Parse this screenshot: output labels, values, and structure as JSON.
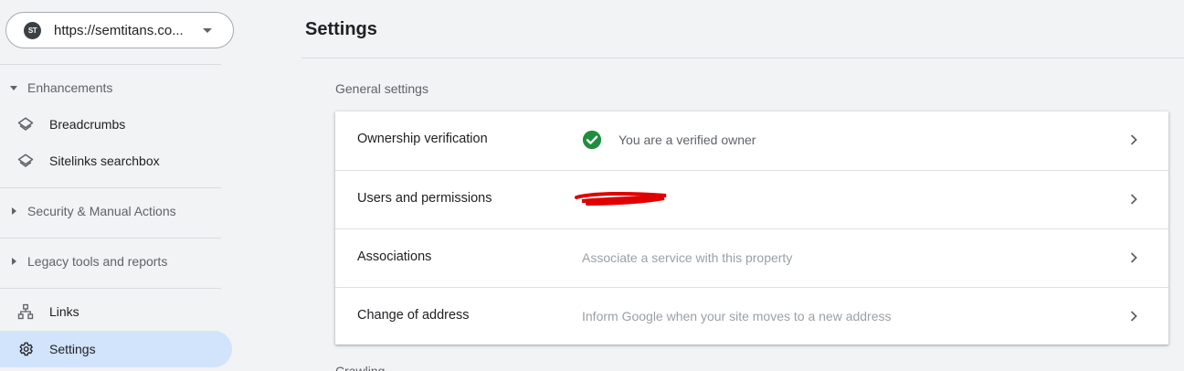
{
  "sidebar": {
    "property": {
      "logo_text": "ST",
      "url": "https://semtitans.co..."
    },
    "sections": {
      "enhancements": "Enhancements",
      "security": "Security & Manual Actions",
      "legacy": "Legacy tools and reports"
    },
    "items": {
      "breadcrumbs": "Breadcrumbs",
      "sitelinks": "Sitelinks searchbox",
      "links": "Links",
      "settings": "Settings"
    }
  },
  "main": {
    "title": "Settings",
    "general_title": "General settings",
    "rows": [
      {
        "label": "Ownership verification",
        "value": "You are a verified owner"
      },
      {
        "label": "Users and permissions",
        "value": ""
      },
      {
        "label": "Associations",
        "value": "Associate a service with this property"
      },
      {
        "label": "Change of address",
        "value": "Inform Google when your site moves to a new address"
      }
    ],
    "next_section_title": "Crawling"
  },
  "colors": {
    "accent_active": "#d2e3fc",
    "verified_green": "#1e8e3e",
    "redaction_red": "#e00000"
  }
}
